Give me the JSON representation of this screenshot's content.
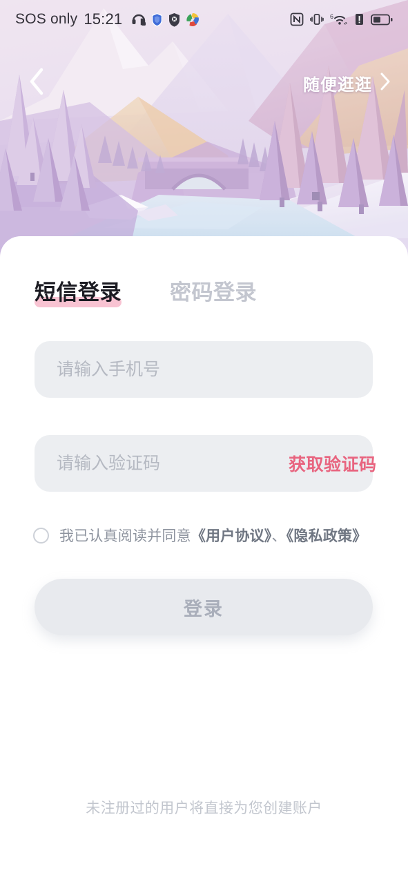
{
  "status_bar": {
    "carrier": "SOS only",
    "time": "15:21",
    "left_icons": [
      "headset-call-icon",
      "shield-blue-icon",
      "shield-block-icon",
      "google-colorful-icon"
    ],
    "right_icons": [
      "nfc-icon",
      "vibrate-icon",
      "wifi6-icon",
      "signal-alert-icon",
      "battery-icon"
    ],
    "wifi_generation": "6"
  },
  "hero": {
    "back_icon": "chevron-left-icon",
    "browse_label": "随便逛逛",
    "browse_chevron": "chevron-right-icon",
    "scene": "low-poly winter mountain valley with pine trees, stone arch bridge and frozen river"
  },
  "tabs": [
    {
      "label": "短信登录",
      "active": true
    },
    {
      "label": "密码登录",
      "active": false
    }
  ],
  "form": {
    "phone": {
      "value": "",
      "placeholder": "请输入手机号"
    },
    "code": {
      "value": "",
      "placeholder": "请输入验证码"
    },
    "send_code_label": "获取验证码"
  },
  "agreement": {
    "checked": false,
    "prefix": "我已认真阅读并同意",
    "doc_user": "《用户协议》",
    "separator": "、",
    "doc_privacy": "《隐私政策》"
  },
  "login_button": {
    "label": "登录",
    "enabled": false
  },
  "footer": {
    "note": "未注册过的用户将直接为您创建账户"
  },
  "colors": {
    "accent_pink": "#e8647f",
    "tab_highlight": "#f8c3d2",
    "field_bg": "#eceef1",
    "button_bg": "#e8eaee",
    "muted_text": "#b5b9c2"
  }
}
